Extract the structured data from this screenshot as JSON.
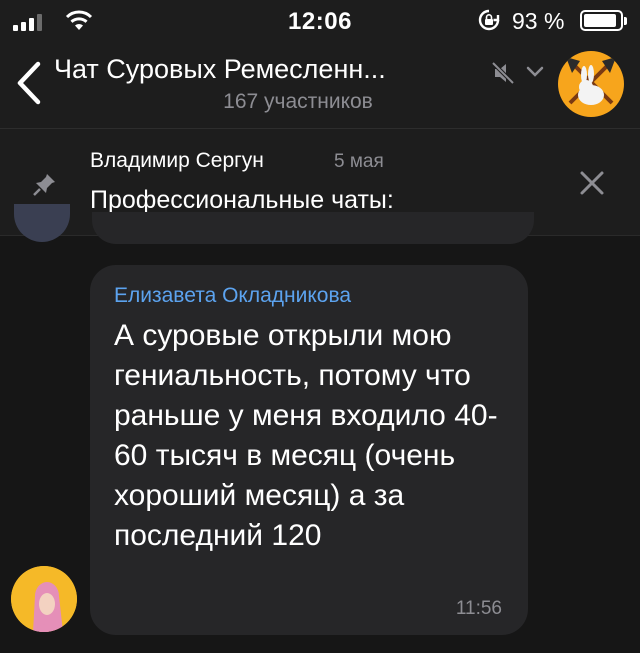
{
  "status_bar": {
    "time": "12:06",
    "battery_percent": "93 %",
    "battery_level": 0.93,
    "icons": [
      "cellular-signal-icon",
      "wifi-icon",
      "orientation-lock-icon",
      "battery-icon"
    ]
  },
  "header": {
    "title": "Чат Суровых Ремесленн...",
    "subtitle": "167 участников",
    "icons": [
      "back-chevron-icon",
      "mute-icon",
      "chevron-down-icon",
      "chat-avatar"
    ]
  },
  "pinned": {
    "author": "Владимир Сергун",
    "date": "5 мая",
    "text": "Профессиональные чаты:",
    "icons": [
      "pin-icon",
      "close-icon"
    ]
  },
  "messages": [
    {
      "sender": "Елизавета Окладникова",
      "text": "А суровые открыли мою гениальность, потому что раньше у меня входило 40-60 тысяч в месяц (очень хороший месяц) а за последний 120",
      "time": "11:56"
    }
  ],
  "colors": {
    "background": "#161616",
    "bar": "#1d1d1d",
    "bubble": "#262628",
    "sender": "#5ca3ef",
    "secondary_text": "#8d8d93",
    "chat_avatar": "#f7a51c"
  }
}
